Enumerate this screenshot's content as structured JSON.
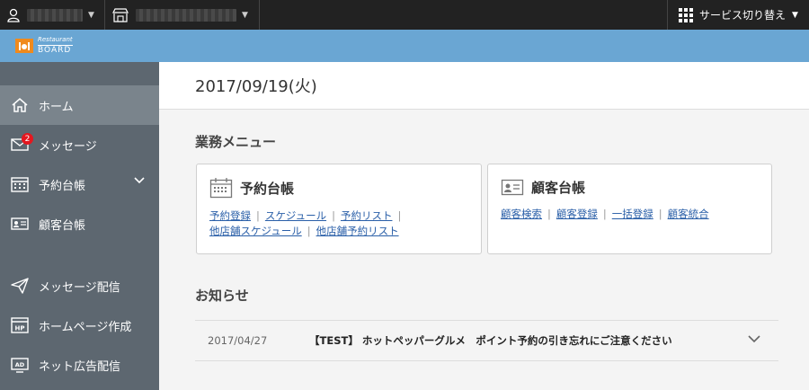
{
  "topbar": {
    "service_label": "サービス切り替え"
  },
  "brand": {
    "line1": "Restaurant",
    "line2": "BOARD"
  },
  "sidebar": {
    "items": [
      {
        "label": "ホーム",
        "icon": "home-icon"
      },
      {
        "label": "メッセージ",
        "icon": "mail-icon",
        "badge": "2"
      },
      {
        "label": "予約台帳",
        "icon": "calendar-icon"
      },
      {
        "label": "顧客台帳",
        "icon": "id-card-icon"
      },
      {
        "label": "メッセージ配信",
        "icon": "paper-plane-icon"
      },
      {
        "label": "ホームページ作成",
        "icon": "hp-icon",
        "icon_text": "HP"
      },
      {
        "label": "ネット広告配信",
        "icon": "ad-icon",
        "icon_text": "AD"
      }
    ]
  },
  "main": {
    "date": "2017/09/19(火)",
    "menu_title": "業務メニュー",
    "cards": [
      {
        "title": "予約台帳",
        "links_line1": [
          "予約登録",
          "スケジュール",
          "予約リスト"
        ],
        "links_line2": [
          "他店舗スケジュール",
          "他店舗予約リスト"
        ]
      },
      {
        "title": "顧客台帳",
        "links_line1": [
          "顧客検索",
          "顧客登録",
          "一括登録",
          "顧客統合"
        ]
      }
    ],
    "news_title": "お知らせ",
    "news": [
      {
        "date": "2017/04/27",
        "text": "【TEST】 ホットペッパーグルメ　ポイント予約の引き忘れにご注意ください"
      }
    ]
  },
  "colors": {
    "topbar": "#222222",
    "brandbar": "#6aa6d3",
    "sidebar": "#5d6770",
    "sidebar_active": "#7a848c",
    "link": "#2a5fa8",
    "badge": "#e5171f",
    "logo": "#f08a1c"
  }
}
